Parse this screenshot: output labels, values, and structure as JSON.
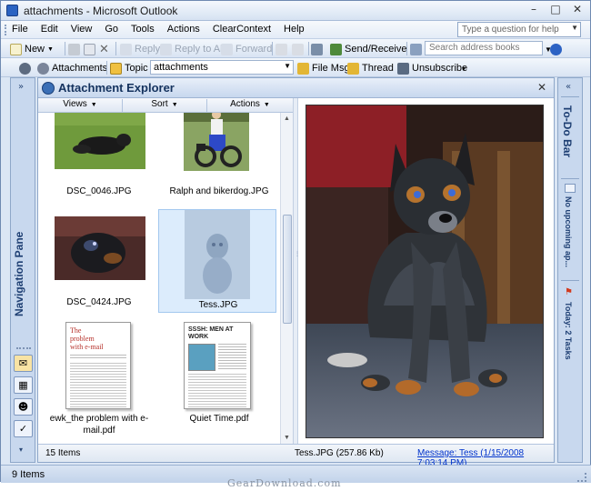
{
  "window": {
    "title": "attachments - Microsoft Outlook"
  },
  "menu": {
    "items": [
      "File",
      "Edit",
      "View",
      "Go",
      "Tools",
      "Actions",
      "ClearContext",
      "Help"
    ],
    "help_placeholder": "Type a question for help"
  },
  "toolbar1": {
    "new_label": "New",
    "reply_label": "Reply",
    "reply_all_label": "Reply to All",
    "forward_label": "Forward",
    "send_receive_label": "Send/Receive",
    "search_placeholder": "Search address books"
  },
  "toolbar2": {
    "attachments_label": "Attachments",
    "topic_label": "Topic",
    "topic_value": "attachments",
    "file_msg_label": "File Msg",
    "thread_label": "Thread",
    "unsubscribe_label": "Unsubscribe"
  },
  "nav_pane": {
    "label": "Navigation Pane"
  },
  "explorer": {
    "title": "Attachment Explorer",
    "subbar": {
      "views": "Views",
      "sort": "Sort",
      "actions": "Actions"
    },
    "items": [
      {
        "caption": "DSC_0046.JPG"
      },
      {
        "caption": "Ralph and bikerdog.JPG"
      },
      {
        "caption": "DSC_0424.JPG"
      },
      {
        "caption": "Tess.JPG"
      },
      {
        "caption": "ewk_the problem with e-mail.pdf",
        "thumb_heading": "The problem with e-mail"
      },
      {
        "caption": "Quiet Time.pdf",
        "thumb_heading": "SSSH: MEN AT WORK"
      }
    ],
    "status": {
      "count": "15 Items",
      "selected": "Tess.JPG (257.86 Kb)",
      "message_link": "Message: Tess (1/15/2008 7:03:14 PM)"
    }
  },
  "todo_bar": {
    "label": "To-Do Bar",
    "appointments": "No upcoming ap...",
    "tasks": "Today: 2 Tasks"
  },
  "app_status": {
    "items": "9 Items"
  },
  "watermark": "GearDownload.com"
}
